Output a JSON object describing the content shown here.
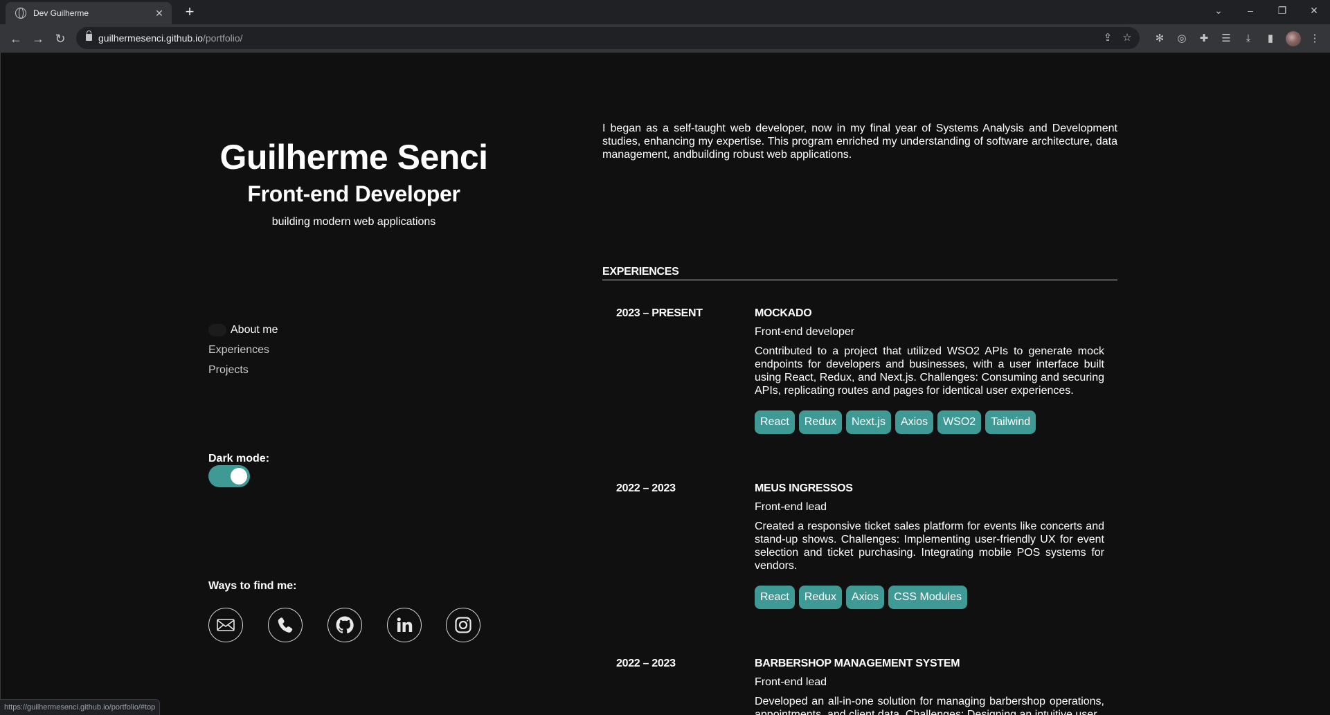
{
  "browser": {
    "tab_title": "Dev Guilherme",
    "url_host": "guilhermesenci.github.io",
    "url_path": "/portfolio/",
    "status_url": "https://guilhermesenci.github.io/portfolio/#top"
  },
  "header": {
    "name": "Guilherme Senci",
    "role": "Front-end Developer",
    "tagline": "building modern web applications"
  },
  "nav": {
    "items": [
      {
        "label": "About me",
        "active": true
      },
      {
        "label": "Experiences",
        "active": false
      },
      {
        "label": "Projects",
        "active": false
      }
    ]
  },
  "settings": {
    "dark_mode_label": "Dark mode:",
    "dark_mode_on": true
  },
  "contact": {
    "label": "Ways to find me:",
    "icons": [
      "mail-icon",
      "phone-icon",
      "github-icon",
      "linkedin-icon",
      "instagram-icon"
    ]
  },
  "about": {
    "text": "I began as a self-taught web developer, now in my final year of Systems Analysis and Development studies, enhancing my expertise. This program enriched my understanding of software architecture, data management, andbuilding robust web applications."
  },
  "experiences": {
    "heading": "EXPERIENCES",
    "jobs": [
      {
        "period": "2023 – PRESENT",
        "company": "MOCKADO",
        "position": "Front-end developer",
        "description": "Contributed to a project that utilized WSO2 APIs to generate mock endpoints for developers and businesses, with a user interface built using React, Redux, and Next.js. Challenges: Consuming and securing APIs, replicating routes and pages for identical user experiences.",
        "tags": [
          "React",
          "Redux",
          "Next.js",
          "Axios",
          "WSO2",
          "Tailwind"
        ]
      },
      {
        "period": "2022 – 2023",
        "company": "MEUS INGRESSOS",
        "position": "Front-end lead",
        "description": "Created a responsive ticket sales platform for events like concerts and stand-up shows. Challenges: Implementing user-friendly UX for event selection and ticket purchasing. Integrating mobile POS systems for vendors.",
        "tags": [
          "React",
          "Redux",
          "Axios",
          "CSS Modules"
        ]
      },
      {
        "period": "2022 – 2023",
        "company": "BARBERSHOP MANAGEMENT SYSTEM",
        "position": "Front-end lead",
        "description": "Developed an all-in-one solution for managing barbershop operations, appointments, and client data. Challenges: Designing an intuitive user",
        "tags": []
      }
    ]
  },
  "colors": {
    "background": "#101010",
    "accent": "#3f9a96",
    "text": "#ffffff"
  }
}
